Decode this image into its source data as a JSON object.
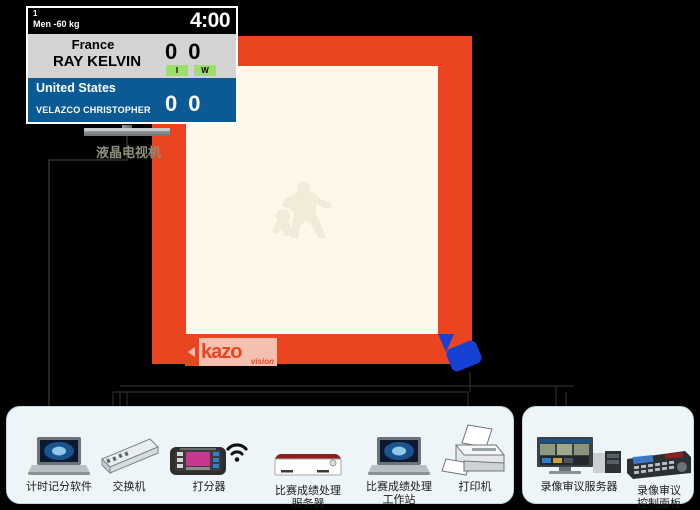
{
  "scoreboard": {
    "bout_number": "1",
    "category": "Men -60 kg",
    "clock": "4:00",
    "white": {
      "country": "France",
      "athlete": "RAY KELVIN",
      "score1": "0",
      "score2": "0"
    },
    "blue": {
      "country": "United States",
      "athlete": "VELAZCO CHRISTOPHER",
      "score1": "0",
      "score2": "0"
    },
    "badges": [
      "I",
      "W"
    ]
  },
  "mat": {
    "logo_word": "kazo",
    "logo_sub": "vision",
    "outer_color": "#ea4420",
    "inner_color": "#fdf8ea"
  },
  "tv": {
    "label": "液晶电视机"
  },
  "camera": {
    "name": "camera",
    "color": "#1740d4"
  },
  "panels": [
    {
      "id": "scoring-panel",
      "devices": [
        {
          "id": "timing-scoring-software",
          "icon": "laptop-icon",
          "label": "计时记分软件"
        },
        {
          "id": "network-switch",
          "icon": "switch-icon",
          "label": "交换机"
        },
        {
          "id": "scoring-device",
          "icon": "scoreboard-controller-icon",
          "label": "打分器"
        },
        {
          "id": "results-server",
          "icon": "server-icon",
          "label": "比赛成绩处理\n服务器"
        },
        {
          "id": "results-workstation",
          "icon": "laptop-icon",
          "label": "比赛成绩处理\n工作站"
        },
        {
          "id": "printer",
          "icon": "printer-icon",
          "label": "打印机"
        }
      ]
    },
    {
      "id": "video-review-panel",
      "devices": [
        {
          "id": "video-review-server",
          "icon": "monitor-rack-icon",
          "label": "录像审议服务器"
        },
        {
          "id": "video-review-control-panel",
          "icon": "control-panel-icon",
          "label": "录像审议\n控制面板"
        }
      ]
    }
  ]
}
